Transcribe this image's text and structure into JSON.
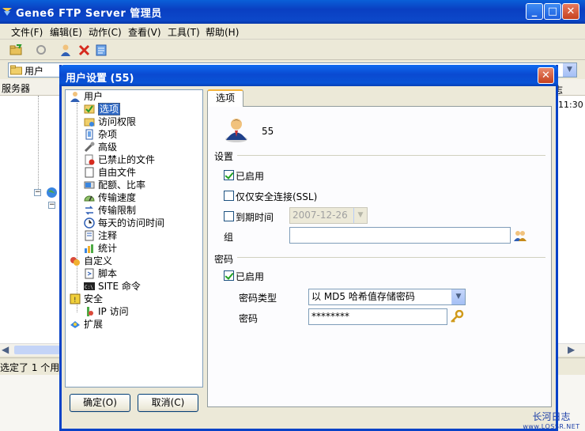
{
  "main_window": {
    "title": "Gene6 FTP Server 管理员",
    "minimize": "_",
    "maximize": "□",
    "close": "✕"
  },
  "menu": [
    "文件(F)",
    "编辑(E)",
    "动作(C)",
    "查看(V)",
    "工具(T)",
    "帮助(H)"
  ],
  "address": {
    "value": "用户"
  },
  "left_header": "服务器",
  "right_partial": {
    "header": "志",
    "time": "11:30"
  },
  "statusbar": {
    "text": "选定了 1 个用"
  },
  "dialog": {
    "title": "用户设置 (55)",
    "close": "✕",
    "tree": [
      {
        "label": "用户",
        "icon": "user-icon",
        "level": 0
      },
      {
        "label": "选项",
        "icon": "options-icon",
        "level": 1,
        "selected": true
      },
      {
        "label": "访问权限",
        "icon": "access-rights-icon",
        "level": 1
      },
      {
        "label": "杂项",
        "icon": "misc-icon",
        "level": 1
      },
      {
        "label": "高级",
        "icon": "advanced-icon",
        "level": 1
      },
      {
        "label": "已禁止的文件",
        "icon": "banned-files-icon",
        "level": 1
      },
      {
        "label": "自由文件",
        "icon": "free-files-icon",
        "level": 1
      },
      {
        "label": "配额、比率",
        "icon": "quota-icon",
        "level": 1
      },
      {
        "label": "传输速度",
        "icon": "speed-icon",
        "level": 1
      },
      {
        "label": "传输限制",
        "icon": "transfer-limit-icon",
        "level": 1
      },
      {
        "label": "每天的访问时间",
        "icon": "clock-icon",
        "level": 1
      },
      {
        "label": "注释",
        "icon": "note-icon",
        "level": 1
      },
      {
        "label": "统计",
        "icon": "stats-icon",
        "level": 1
      },
      {
        "label": "自定义",
        "icon": "custom-icon",
        "level": 0
      },
      {
        "label": "脚本",
        "icon": "script-icon",
        "level": 1
      },
      {
        "label": "SITE 命令",
        "icon": "site-command-icon",
        "level": 1
      },
      {
        "label": "安全",
        "icon": "security-icon",
        "level": 0
      },
      {
        "label": "IP 访问",
        "icon": "ip-access-icon",
        "level": 1
      },
      {
        "label": "扩展",
        "icon": "extension-icon",
        "level": 0
      }
    ],
    "tab": "选项",
    "user_name": "55",
    "settings_group": "设置",
    "enabled_label": "已启用",
    "enabled_checked": true,
    "ssl_only_label": "仅仅安全连接(SSL)",
    "ssl_only_checked": false,
    "expire_label": "到期时间",
    "expire_checked": false,
    "expire_date": "2007-12-26",
    "group_label": "组",
    "group_value": "",
    "password_group": "密码",
    "pw_enabled_label": "已启用",
    "pw_enabled_checked": true,
    "pw_type_label": "密码类型",
    "pw_type_value": "以 MD5 哈希值存储密码",
    "pw_label": "密码",
    "pw_value": "********",
    "ok_button": "确定(O)",
    "cancel_button": "取消(C)"
  },
  "watermark": {
    "line1": "长河日志",
    "line2": "www.LOSSR.NET"
  },
  "colors": {
    "xp_blue": "#0a4ad1",
    "selection": "#316ac5",
    "tab_accent": "#f4b43a",
    "checkmark": "#21a121"
  }
}
